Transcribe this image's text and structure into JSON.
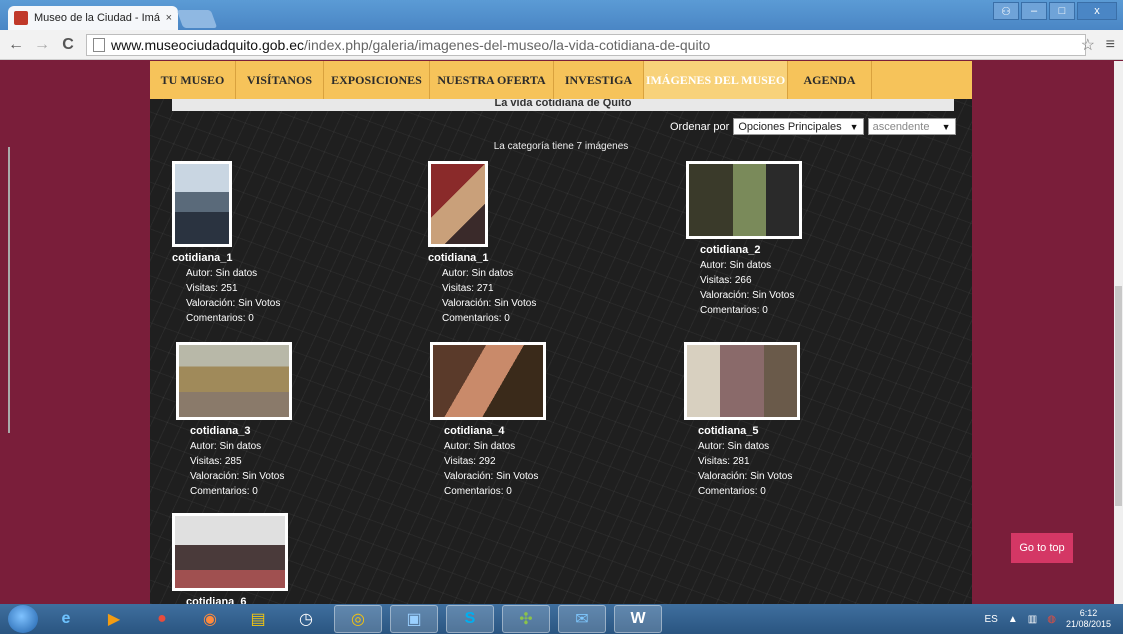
{
  "browser": {
    "tab_title": "Museo de la Ciudad - Imá",
    "tab_close": "×",
    "url_host": "www.museociudadquito.gob.ec",
    "url_path": "/index.php/galeria/imagenes-del-museo/la-vida-cotidiana-de-quito",
    "back": "←",
    "forward": "→",
    "reload": "C",
    "star": "☆",
    "menu": "≡",
    "win_min": "–",
    "win_max": "□",
    "win_close": "x"
  },
  "nav": {
    "items": [
      {
        "label": "TU MUSEO"
      },
      {
        "label": "VISÍTANOS"
      },
      {
        "label": "EXPOSICIONES"
      },
      {
        "label": "NUESTRA OFERTA"
      },
      {
        "label": "INVESTIGA"
      },
      {
        "label": "IMÁGENES DEL MUSEO"
      },
      {
        "label": "AGENDA"
      }
    ]
  },
  "gallery": {
    "title": "La vida cotidiana de Quito",
    "sort_label": "Ordenar por",
    "sort_field": "Opciones Principales",
    "sort_order": "ascendente",
    "count_text": "La categoría tiene 7 imágenes",
    "items": [
      {
        "name": "cotidiana_1",
        "autor": "Autor: Sin datos",
        "visitas": "Visitas: 251",
        "valoracion": "Valoración: Sin Votos",
        "comentarios": "Comentarios: 0"
      },
      {
        "name": "cotidiana_1",
        "autor": "Autor: Sin datos",
        "visitas": "Visitas: 271",
        "valoracion": "Valoración: Sin Votos",
        "comentarios": "Comentarios: 0"
      },
      {
        "name": "cotidiana_2",
        "autor": "Autor: Sin datos",
        "visitas": "Visitas: 266",
        "valoracion": "Valoración: Sin Votos",
        "comentarios": "Comentarios: 0"
      },
      {
        "name": "cotidiana_3",
        "autor": "Autor: Sin datos",
        "visitas": "Visitas: 285",
        "valoracion": "Valoración: Sin Votos",
        "comentarios": "Comentarios: 0"
      },
      {
        "name": "cotidiana_4",
        "autor": "Autor: Sin datos",
        "visitas": "Visitas: 292",
        "valoracion": "Valoración: Sin Votos",
        "comentarios": "Comentarios: 0"
      },
      {
        "name": "cotidiana_5",
        "autor": "Autor: Sin datos",
        "visitas": "Visitas: 281",
        "valoracion": "Valoración: Sin Votos",
        "comentarios": "Comentarios: 0"
      },
      {
        "name": "cotidiana_6"
      }
    ]
  },
  "go_top": "Go to top",
  "taskbar": {
    "lang": "ES",
    "time": "6:12",
    "date": "21/08/2015"
  },
  "colors": {
    "page_bg": "#7a1e3a",
    "nav_bg": "#f6c35a",
    "go_top_bg": "#d43765"
  }
}
